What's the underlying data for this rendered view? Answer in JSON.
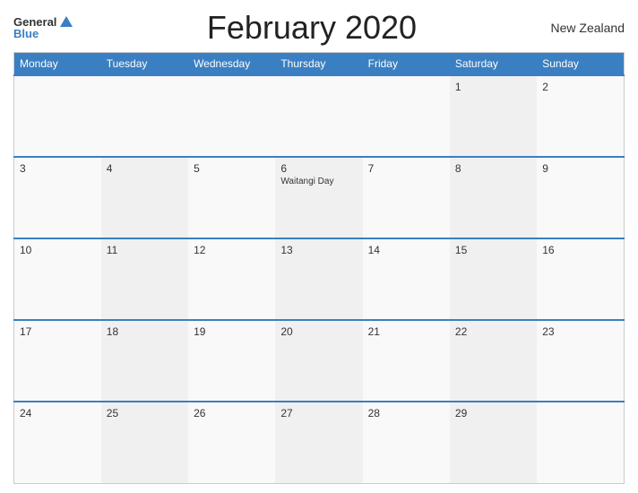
{
  "header": {
    "logo_general": "General",
    "logo_blue": "Blue",
    "title": "February 2020",
    "country": "New Zealand"
  },
  "calendar": {
    "days": [
      "Monday",
      "Tuesday",
      "Wednesday",
      "Thursday",
      "Friday",
      "Saturday",
      "Sunday"
    ],
    "weeks": [
      [
        {
          "date": "",
          "event": ""
        },
        {
          "date": "",
          "event": ""
        },
        {
          "date": "",
          "event": ""
        },
        {
          "date": "",
          "event": ""
        },
        {
          "date": "",
          "event": ""
        },
        {
          "date": "1",
          "event": ""
        },
        {
          "date": "2",
          "event": ""
        }
      ],
      [
        {
          "date": "3",
          "event": ""
        },
        {
          "date": "4",
          "event": ""
        },
        {
          "date": "5",
          "event": ""
        },
        {
          "date": "6",
          "event": "Waitangi Day"
        },
        {
          "date": "7",
          "event": ""
        },
        {
          "date": "8",
          "event": ""
        },
        {
          "date": "9",
          "event": ""
        }
      ],
      [
        {
          "date": "10",
          "event": ""
        },
        {
          "date": "11",
          "event": ""
        },
        {
          "date": "12",
          "event": ""
        },
        {
          "date": "13",
          "event": ""
        },
        {
          "date": "14",
          "event": ""
        },
        {
          "date": "15",
          "event": ""
        },
        {
          "date": "16",
          "event": ""
        }
      ],
      [
        {
          "date": "17",
          "event": ""
        },
        {
          "date": "18",
          "event": ""
        },
        {
          "date": "19",
          "event": ""
        },
        {
          "date": "20",
          "event": ""
        },
        {
          "date": "21",
          "event": ""
        },
        {
          "date": "22",
          "event": ""
        },
        {
          "date": "23",
          "event": ""
        }
      ],
      [
        {
          "date": "24",
          "event": ""
        },
        {
          "date": "25",
          "event": ""
        },
        {
          "date": "26",
          "event": ""
        },
        {
          "date": "27",
          "event": ""
        },
        {
          "date": "28",
          "event": ""
        },
        {
          "date": "29",
          "event": ""
        },
        {
          "date": "",
          "event": ""
        }
      ]
    ]
  }
}
